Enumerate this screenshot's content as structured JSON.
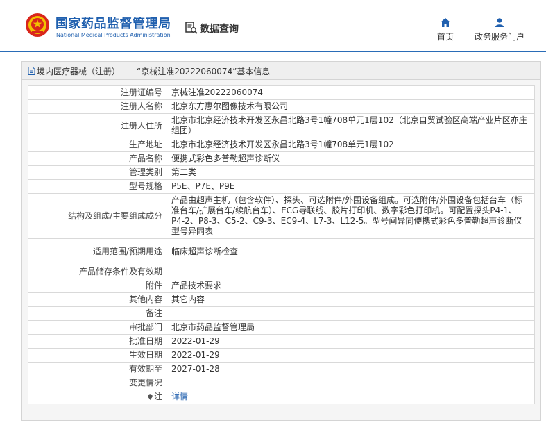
{
  "header": {
    "brand_cn": "国家药品监督管理局",
    "brand_en": "National Medical Products Administration",
    "data_query": "数据查询",
    "nav": {
      "home": "首页",
      "gov": "政务服务门户"
    },
    "accent": "#1f5fae"
  },
  "panel": {
    "title": "境内医疗器械（注册）——“京械注准20222060074”基本信息"
  },
  "rows": [
    {
      "key": "注册证编号",
      "value": "京械注准20222060074"
    },
    {
      "key": "注册人名称",
      "value": "北京东方惠尔图像技术有限公司"
    },
    {
      "key": "注册人住所",
      "value": "北京市北京经济技术开发区永昌北路3号1幢708单元1层102（北京自贸试验区高端产业片区亦庄组团）"
    },
    {
      "key": "生产地址",
      "value": "北京市北京经济技术开发区永昌北路3号1幢708单元1层102"
    },
    {
      "key": "产品名称",
      "value": "便携式彩色多普勒超声诊断仪"
    },
    {
      "key": "管理类别",
      "value": "第二类"
    },
    {
      "key": "型号规格",
      "value": "P5E、P7E、P9E"
    },
    {
      "key": "结构及组成/主要组成成分",
      "value": "产品由超声主机（包含软件）、探头、可选附件/外围设备组成。可选附件/外围设备包括台车（标准台车/扩展台车/续航台车）、ECG导联线、胶片打印机、数字彩色打印机。可配置探头P4-1、P4-2、P8-3、C5-2、C9-3、EC9-4、L7-3、L12-5。型号间异同便携式彩色多普勒超声诊断仪型号异同表"
    },
    {
      "key": "适用范围/预期用途",
      "value": "临床超声诊断检查"
    },
    {
      "key": "产品储存条件及有效期",
      "value": "-"
    },
    {
      "key": "附件",
      "value": "产品技术要求"
    },
    {
      "key": "其他内容",
      "value": "其它内容"
    },
    {
      "key": "备注",
      "value": ""
    },
    {
      "key": "审批部门",
      "value": "北京市药品监督管理局"
    },
    {
      "key": "批准日期",
      "value": "2022-01-29"
    },
    {
      "key": "生效日期",
      "value": "2022-01-29"
    },
    {
      "key": "有效期至",
      "value": "2027-01-28"
    },
    {
      "key": "变更情况",
      "value": ""
    }
  ],
  "note_row": {
    "key": "注",
    "link": "详情"
  }
}
